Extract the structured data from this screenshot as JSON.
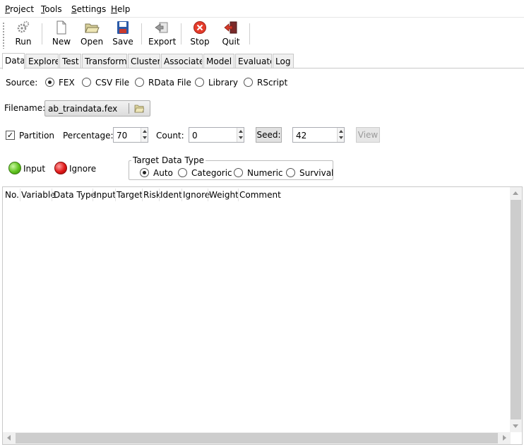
{
  "menu": [
    {
      "underline": "P",
      "rest": "roject"
    },
    {
      "underline": "T",
      "rest": "ools"
    },
    {
      "underline": "S",
      "rest": "ettings"
    },
    {
      "underline": "H",
      "rest": "elp"
    }
  ],
  "toolbar": {
    "run": "Run",
    "new": "New",
    "open": "Open",
    "save": "Save",
    "export": "Export",
    "stop": "Stop",
    "quit": "Quit"
  },
  "tabs": [
    "Data",
    "Explore",
    "Test",
    "Transform",
    "Cluster",
    "Associate",
    "Model",
    "Evaluate",
    "Log"
  ],
  "active_tab": "Data",
  "source": {
    "label": "Source:",
    "options": [
      "FEX",
      "CSV File",
      "RData File",
      "Library",
      "RScript"
    ],
    "selected": "FEX"
  },
  "filename": {
    "label": "Filename:",
    "value": "ab_traindata.fex"
  },
  "partition": {
    "label": "Partition",
    "checked": true,
    "percentage_label": "Percentage:",
    "percentage": "70",
    "count_label": "Count:",
    "count": "0",
    "seed_button": "Seed:",
    "seed": "42",
    "view_button": "View"
  },
  "roles": {
    "input": "Input",
    "ignore": "Ignore"
  },
  "target_type": {
    "title": "Target Data Type",
    "options": [
      "Auto",
      "Categoric",
      "Numeric",
      "Survival"
    ],
    "selected": "Auto"
  },
  "table": {
    "columns": [
      "No.",
      "Variable",
      "Data Type",
      "Input",
      "Target",
      "Risk",
      "Ident",
      "Ignore",
      "Weight",
      "Comment"
    ],
    "rows": []
  },
  "colors": {
    "input_light": "#5fc21e",
    "ignore_light": "#e01818",
    "stop_icon": "#e53c2b",
    "save_icon": "#2b5aa8"
  }
}
